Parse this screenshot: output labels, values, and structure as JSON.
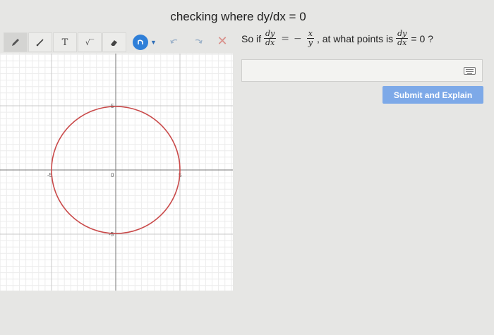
{
  "header": {
    "title": "checking where dy/dx = 0"
  },
  "toolbar": {
    "tools": [
      {
        "name": "pencil-tool",
        "icon": "pencil-icon"
      },
      {
        "name": "line-tool",
        "icon": "line-icon"
      },
      {
        "name": "text-tool",
        "icon": "text-icon",
        "label": "T"
      },
      {
        "name": "sqrt-tool",
        "icon": "sqrt-icon",
        "label": "√‾"
      },
      {
        "name": "eraser-tool",
        "icon": "eraser-icon"
      }
    ],
    "active_color": "#2f7fd8",
    "undo_icon": "undo-icon",
    "redo_icon": "redo-icon",
    "clear_label": "✕"
  },
  "question": {
    "prefix": "So if",
    "frac1": {
      "num": "dy",
      "den": "dx"
    },
    "equals": "=",
    "minus": "−",
    "frac2": {
      "num": "x",
      "den": "y"
    },
    "middle": ", at what points is",
    "frac3": {
      "num": "dy",
      "den": "dx"
    },
    "suffix": "= 0 ?"
  },
  "answer": {
    "value": "",
    "keyboard_icon": "keyboard-icon"
  },
  "submit": {
    "label": "Submit and Explain"
  },
  "graph": {
    "x_labels": [
      "-5",
      "0",
      "5"
    ],
    "y_labels": [
      "5",
      "-5"
    ],
    "circle_color": "#c94a4a",
    "circle": {
      "cx": 0,
      "cy": 0,
      "r": 5
    }
  }
}
